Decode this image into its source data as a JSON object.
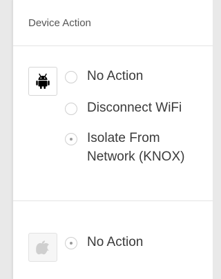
{
  "panel": {
    "title": "Device Action"
  },
  "android": {
    "icon": "android-icon",
    "options": [
      {
        "label": "No Action",
        "checked": false
      },
      {
        "label": "Disconnect WiFi",
        "checked": false
      },
      {
        "label": "Isolate From Network (KNOX)",
        "checked": true
      }
    ]
  },
  "apple": {
    "icon": "apple-icon",
    "options": [
      {
        "label": "No Action",
        "checked": true
      }
    ]
  },
  "colors": {
    "text": "#3a3a3a",
    "border": "#e4e4e4",
    "radio_dot": "#9a9a9a"
  }
}
